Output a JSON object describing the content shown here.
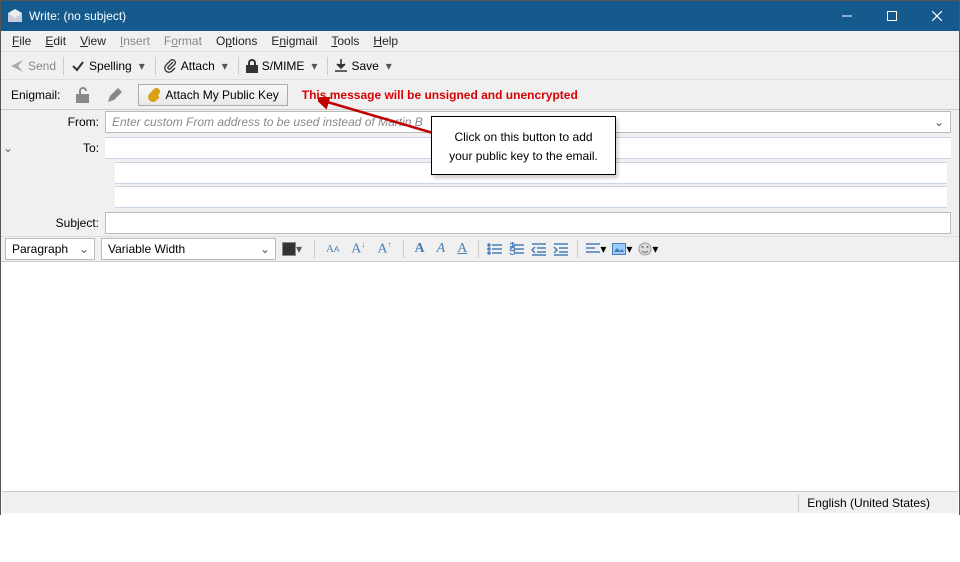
{
  "titlebar": {
    "title": "Write: (no subject)"
  },
  "menu": {
    "file": "File",
    "edit": "Edit",
    "view": "View",
    "insert": "Insert",
    "format": "Format",
    "options": "Options",
    "enigmail": "Enigmail",
    "tools": "Tools",
    "help": "Help"
  },
  "toolbar": {
    "send": "Send",
    "spelling": "Spelling",
    "attach": "Attach",
    "smime": "S/MIME",
    "save": "Save"
  },
  "enigbar": {
    "label": "Enigmail:",
    "attach_key": "Attach My Public Key",
    "warning": "This message will be unsigned and unencrypted"
  },
  "headers": {
    "from_label": "From:",
    "from_placeholder": "Enter custom From address to be used instead of Martin B",
    "to_label": "To:",
    "subject_label": "Subject:"
  },
  "format": {
    "para_style": "Paragraph",
    "font_family": "Variable Width"
  },
  "status": {
    "language": "English (United States)"
  },
  "callout": {
    "text": "Click on this button to add your public key to the email."
  }
}
